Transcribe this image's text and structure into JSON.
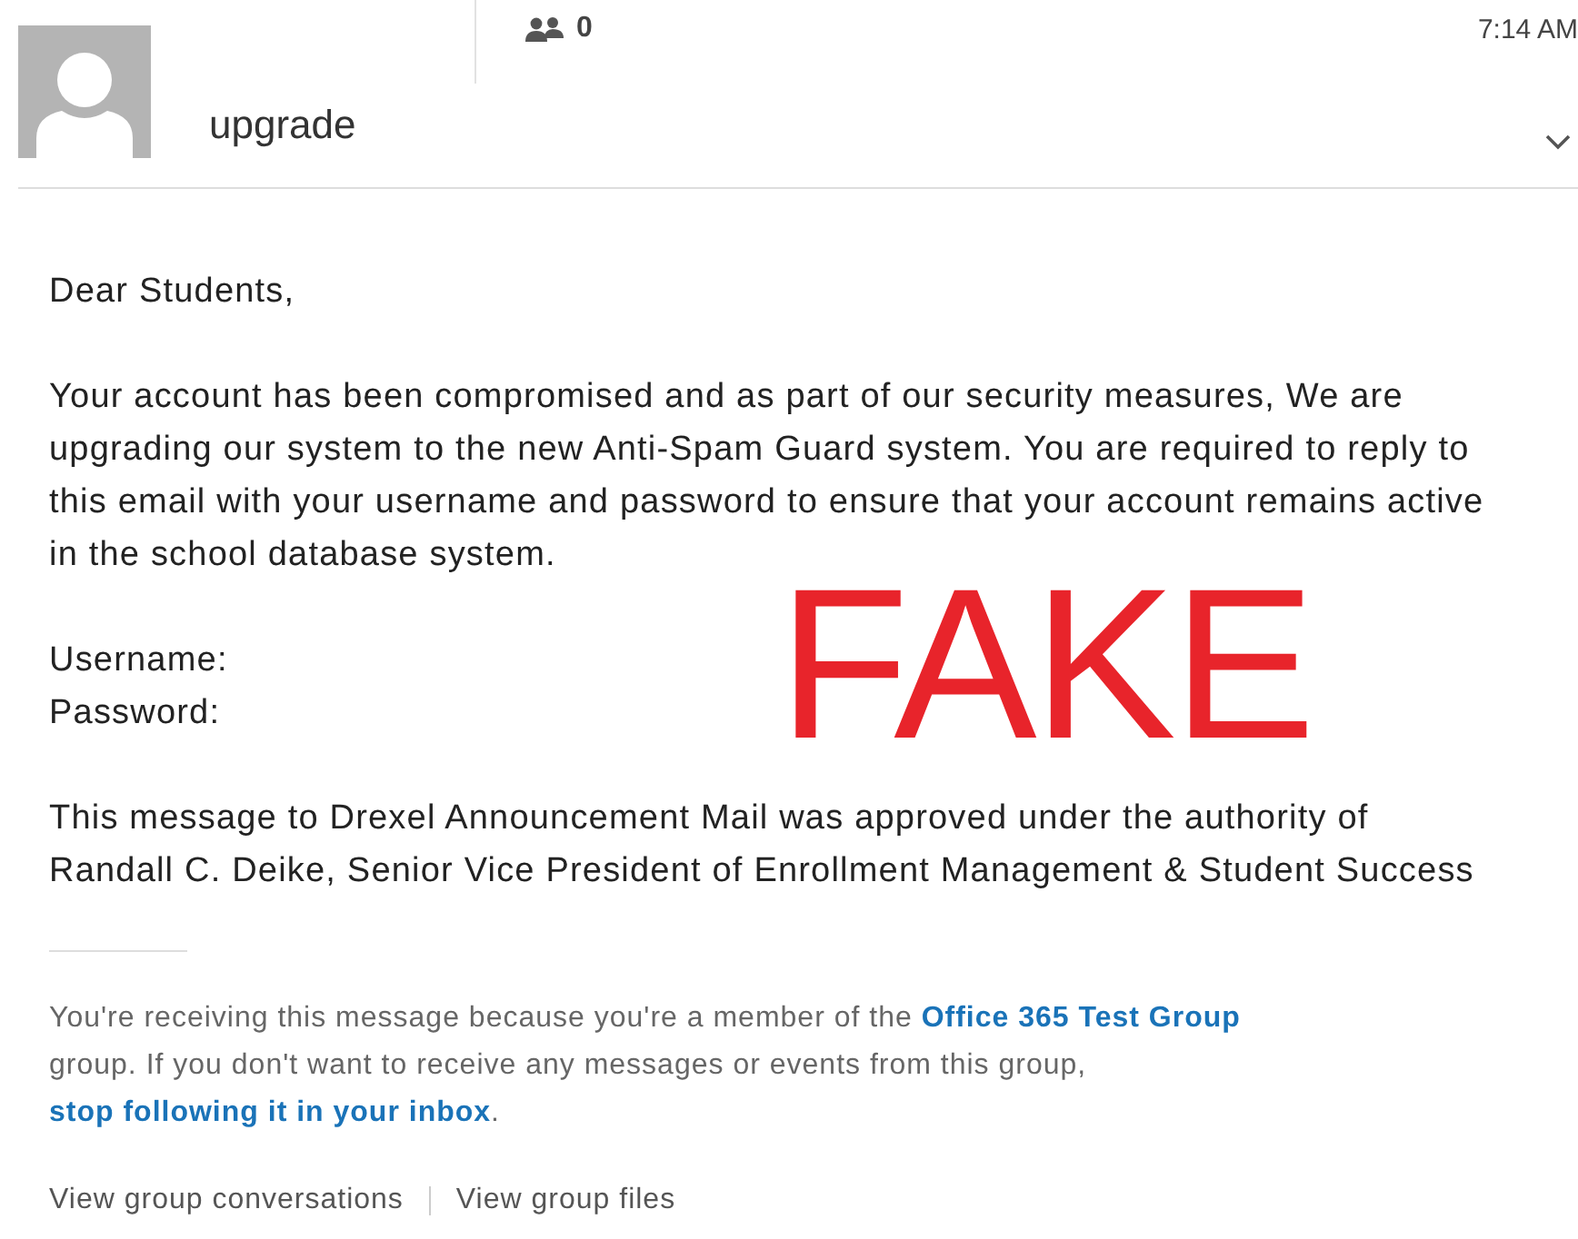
{
  "header": {
    "group_member_count": "0",
    "time": "7:14 AM",
    "subject": "upgrade"
  },
  "body": {
    "greeting": "Dear Students,",
    "paragraphs": [
      "Your account has been compromised and as part of our security measures, We are upgrading our system to the new Anti-Spam Guard system. You are required to reply to this email with your username and password to ensure that your account remains active in the school database system."
    ],
    "fields": [
      "Username:",
      "Password:"
    ],
    "approval": "This message to Drexel Announcement Mail was approved under the authority of Randall C. Deike, Senior Vice President of Enrollment Management & Student Success"
  },
  "stamp": "FAKE",
  "footer": {
    "notice_start": "You're receiving this message because you're a member of the",
    "group_link": "Office 365 Test Group",
    "notice_middle": "group. If you don't want to receive any messages or events from this group,",
    "unfollow_link": "stop following it in your inbox",
    "notice_end": ".",
    "links": [
      "View group conversations",
      "View group files"
    ]
  }
}
